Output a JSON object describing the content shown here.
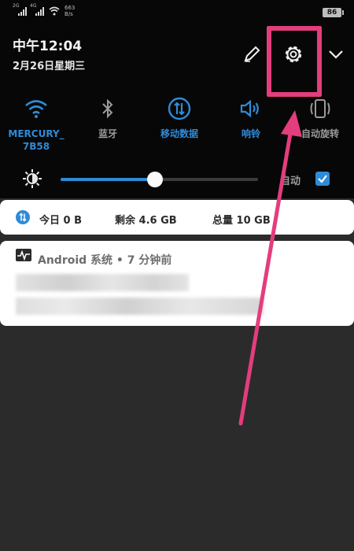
{
  "status_bar": {
    "sim1_label": "2G",
    "sim2_label": "4G",
    "net_speed_value": "663",
    "net_speed_unit": "B/s",
    "battery_level": "86"
  },
  "header": {
    "time": "中午12:04",
    "date": "2月26日星期三",
    "edit_icon": "pencil-icon",
    "settings_icon": "gear-icon",
    "expand_icon": "chevron-down-icon"
  },
  "toggles": [
    {
      "label": "MERCURY_\n7B58",
      "icon": "wifi-icon",
      "active": true
    },
    {
      "label": "蓝牙",
      "icon": "bluetooth-icon",
      "active": false
    },
    {
      "label": "移动数据",
      "icon": "mobile-data-icon",
      "active": true
    },
    {
      "label": "响铃",
      "icon": "volume-icon",
      "active": true
    },
    {
      "label": "自动旋转",
      "icon": "rotate-icon",
      "active": false
    }
  ],
  "brightness": {
    "level_percent": 48,
    "auto_label": "自动",
    "auto_checked": true
  },
  "data_usage": {
    "today": "今日 0 B",
    "remaining": "剩余 4.6 GB",
    "total": "总量 10 GB"
  },
  "notification": {
    "app": "Android 系统",
    "separator": "•",
    "time_ago": "7 分钟前"
  },
  "colors": {
    "accent": "#2f8bd8",
    "annotation": "#e33d7d",
    "shade_bg": "#070707",
    "page_bg": "#2b2b2b"
  }
}
